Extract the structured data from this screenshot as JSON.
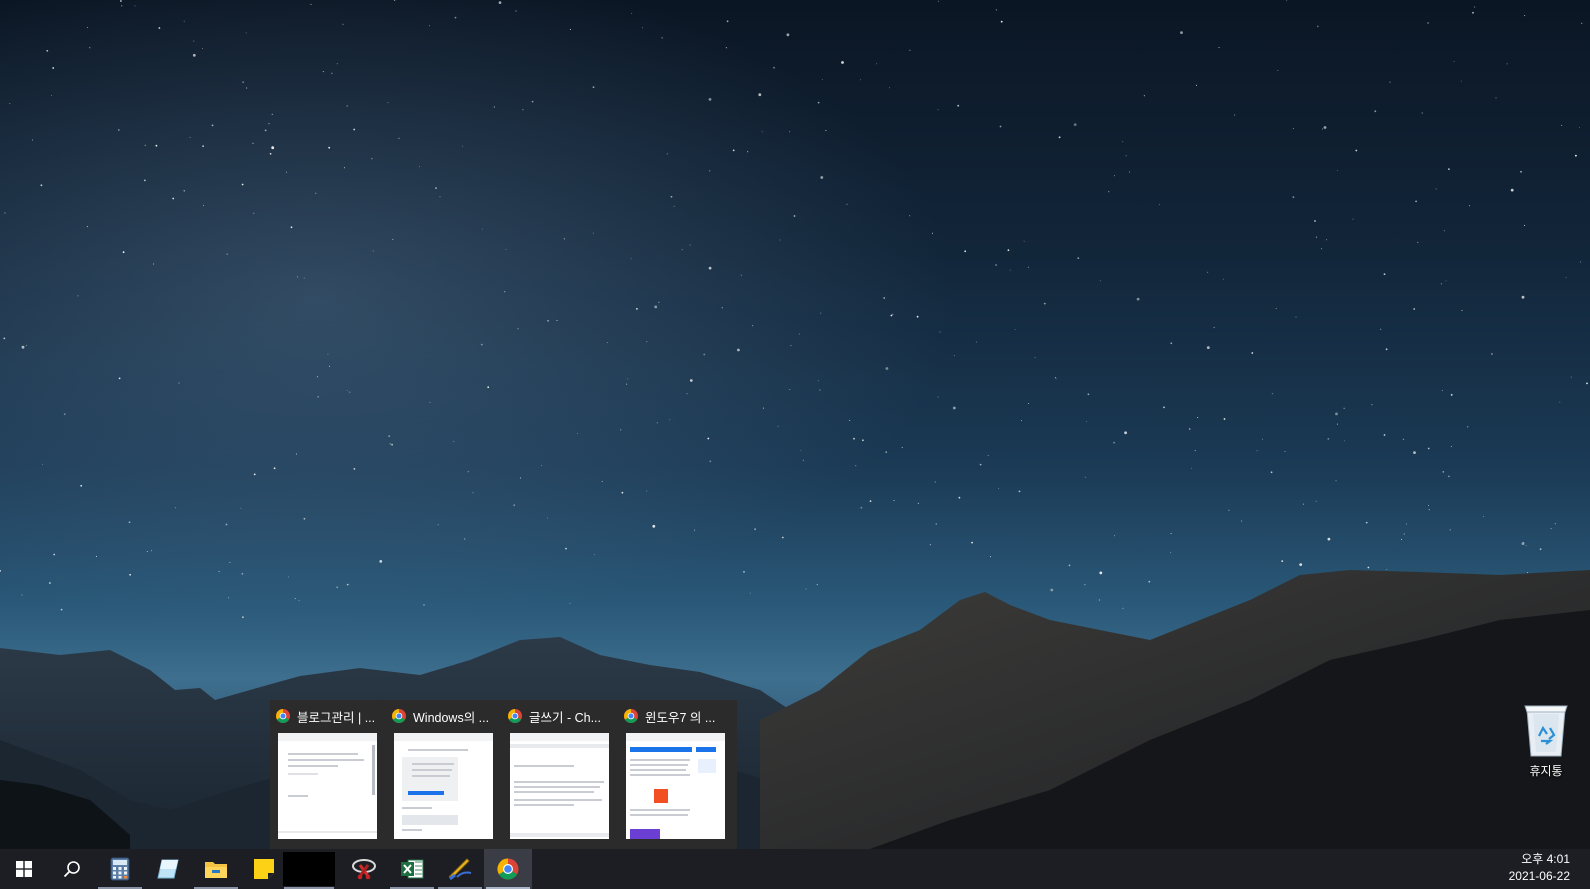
{
  "desktop": {
    "recycle_bin_label": "휴지통"
  },
  "thumbnails": [
    {
      "title": "블로그관리 | ...",
      "page_text": "블로그관리",
      "page_text_2": ""
    },
    {
      "title": "Windows의 ...",
      "page_text": "",
      "page_text_2": ""
    },
    {
      "title": "글쓰기 - Ch...",
      "page_text": "",
      "page_text_2": ""
    },
    {
      "title": "윈도우7 의 ...",
      "page_text": "",
      "page_text_2": ""
    }
  ],
  "taskbar": {
    "items": [
      {
        "name": "start-button",
        "icon": "windows-logo-icon"
      },
      {
        "name": "search-button",
        "icon": "search-icon"
      },
      {
        "name": "calculator-app",
        "icon": "calculator-icon"
      },
      {
        "name": "draw-app",
        "icon": "eraser-icon"
      },
      {
        "name": "file-explorer-app",
        "icon": "folder-icon"
      },
      {
        "name": "sticky-notes-app",
        "icon": "sticky-note-icon"
      },
      {
        "name": "black-window-app",
        "icon": "black-window-icon"
      },
      {
        "name": "snipping-tool-app",
        "icon": "snip-icon"
      },
      {
        "name": "excel-app",
        "icon": "excel-icon"
      },
      {
        "name": "pen-app",
        "icon": "pen-icon"
      },
      {
        "name": "chrome-app",
        "icon": "chrome-icon"
      }
    ],
    "clock_time": "오후 4:01",
    "clock_date": "2021-06-22"
  },
  "colors": {
    "taskbar_bg": "#1c1e24",
    "flyout_bg": "#2b2b2b",
    "excel_green": "#1d6f42",
    "chrome_red": "#db4437",
    "chrome_yellow": "#f4b400",
    "chrome_green": "#0f9d58",
    "chrome_blue": "#4285f4"
  }
}
